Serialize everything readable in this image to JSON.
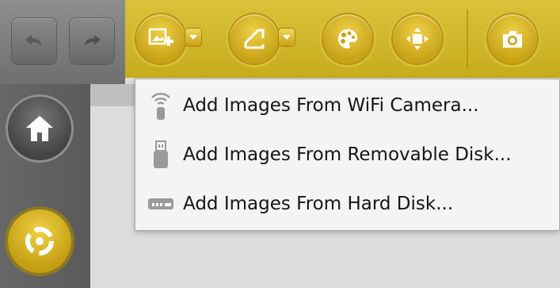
{
  "toolbar": {
    "undo_icon": "undo-icon",
    "redo_icon": "redo-icon",
    "buttons": [
      "add-images-icon",
      "crop-icon",
      "color-palette-icon",
      "resize-icon",
      "camera-icon"
    ]
  },
  "add_images_menu": {
    "items": [
      {
        "label": "Add Images From WiFi Camera...",
        "icon": "wifi-icon"
      },
      {
        "label": "Add Images From Removable Disk...",
        "icon": "usb-drive-icon"
      },
      {
        "label": "Add Images From Hard Disk...",
        "icon": "hard-disk-icon"
      }
    ]
  },
  "sidebar": {
    "home_icon": "home-icon",
    "location_icon": "location-icon"
  },
  "colors": {
    "accent_yellow": "#d1b427",
    "toolbar_gray": "#777777",
    "menu_bg": "#f4f4f4"
  }
}
